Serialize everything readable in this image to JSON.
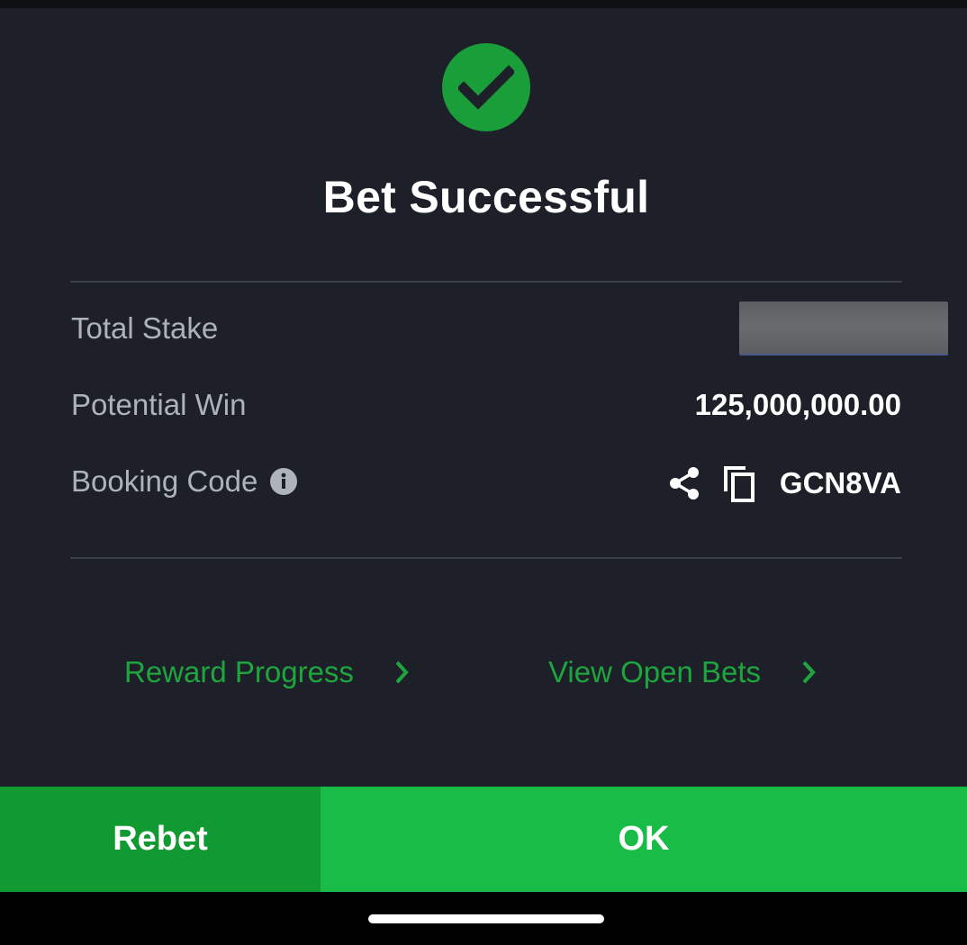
{
  "dialog": {
    "title": "Bet Successful",
    "status_icon": "check-circle-icon"
  },
  "details": {
    "total_stake": {
      "label": "Total Stake",
      "value_masked": true
    },
    "potential_win": {
      "label": "Potential Win",
      "value": "125,000,000.00"
    },
    "booking_code": {
      "label": "Booking Code",
      "value": "GCN8VA",
      "info_icon": "info-icon",
      "share_icon": "share-icon",
      "copy_icon": "copy-icon"
    }
  },
  "links": {
    "reward_progress": "Reward Progress",
    "view_open_bets": "View Open Bets"
  },
  "buttons": {
    "rebet": "Rebet",
    "ok": "OK"
  },
  "colors": {
    "background": "#1d2028",
    "accent_green": "#1ea53e",
    "ok_button": "#18bc47",
    "rebet_button": "#129a32",
    "label_gray": "#aeb2ba",
    "divider": "#3a3e47"
  }
}
